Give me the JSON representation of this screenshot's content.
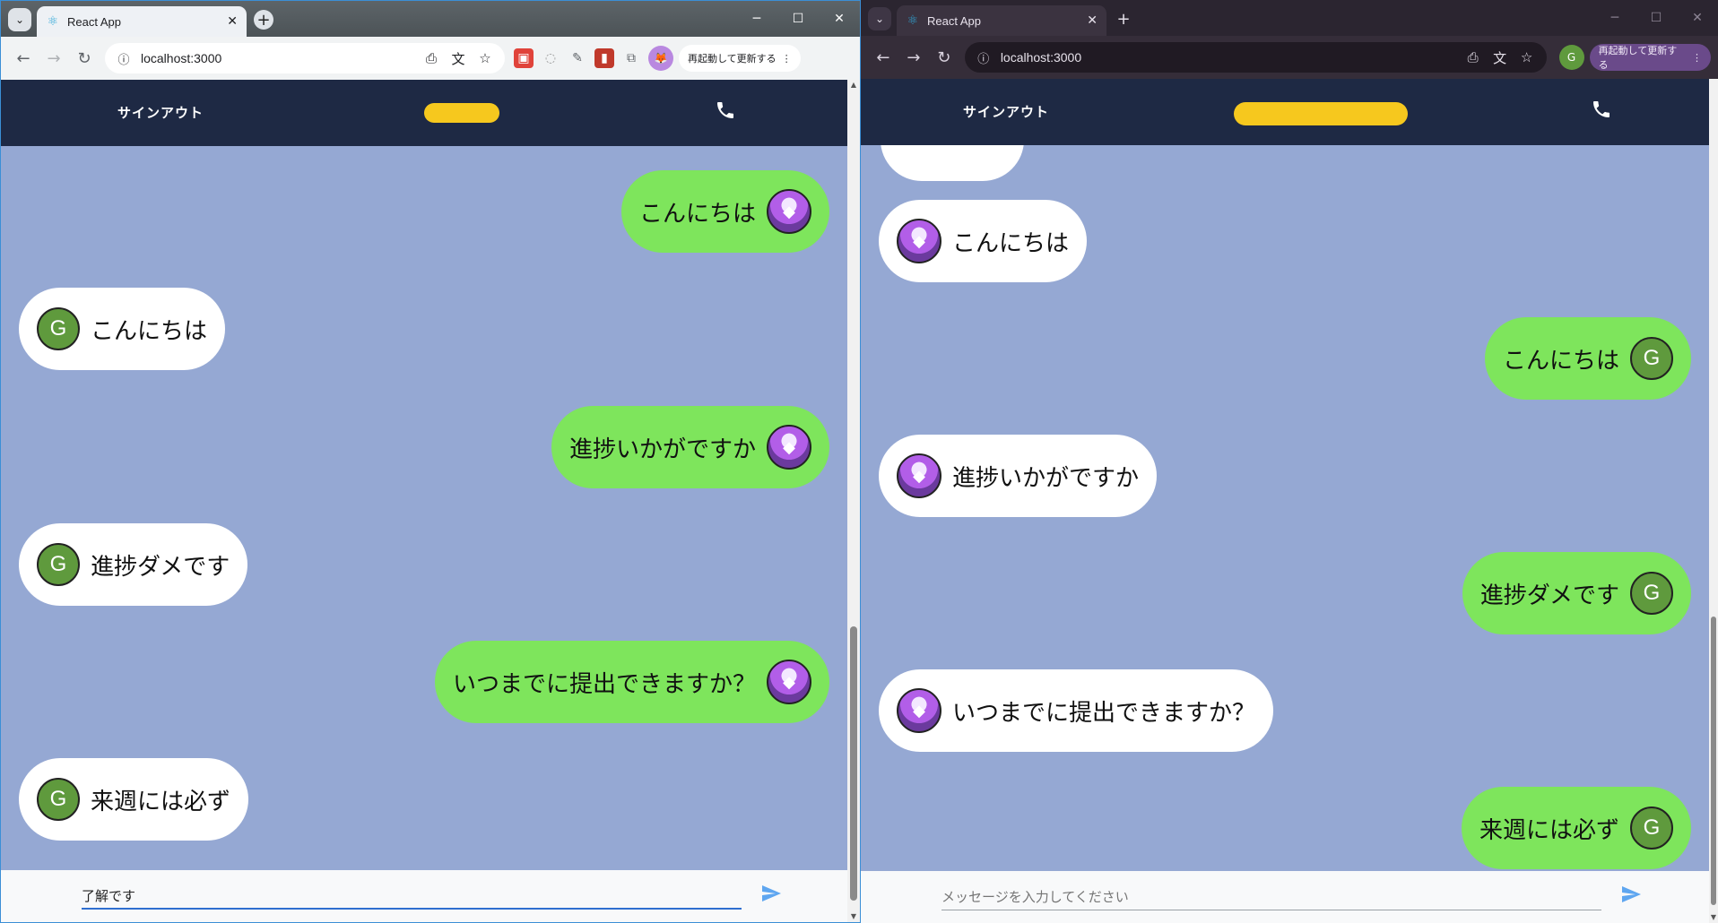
{
  "left": {
    "tab_title": "React App",
    "url": "localhost:3000",
    "relaunch_label": "再起動して更新する",
    "header": {
      "signout": "サインアウト"
    },
    "messages": [
      {
        "side": "mine",
        "text": "こんにちは"
      },
      {
        "side": "theirs",
        "text": "こんにちは",
        "avatar": "G"
      },
      {
        "side": "mine",
        "text": "進捗いかがですか"
      },
      {
        "side": "theirs",
        "text": "進捗ダメです",
        "avatar": "G"
      },
      {
        "side": "mine",
        "text": "いつまでに提出できますか？"
      },
      {
        "side": "theirs",
        "text": "来週には必ず",
        "avatar": "G"
      }
    ],
    "input_value": "了解です"
  },
  "right": {
    "tab_title": "React App",
    "url": "localhost:3000",
    "relaunch_label": "再起動して更新する",
    "profile_letter": "G",
    "header": {
      "signout": "サインアウト"
    },
    "messages": [
      {
        "side": "theirs",
        "text": "こんにちは"
      },
      {
        "side": "mine",
        "text": "こんにちは",
        "avatar": "G"
      },
      {
        "side": "theirs",
        "text": "進捗いかがですか"
      },
      {
        "side": "mine",
        "text": "進捗ダメです",
        "avatar": "G"
      },
      {
        "side": "theirs",
        "text": "いつまでに提出できますか？"
      },
      {
        "side": "mine",
        "text": "来週には必ず",
        "avatar": "G"
      }
    ],
    "input_placeholder": "メッセージを入力してください"
  },
  "colors": {
    "header_bg": "#1e2944",
    "chat_bg": "#95a8d3",
    "mine_bubble": "#7ee55c",
    "theirs_bubble": "#ffffff",
    "avatar_g": "#5f9a3d",
    "scribble": "#f6c81e",
    "send_icon": "#5ea6f0"
  },
  "icons": [
    "tab-dropdown-icon",
    "react-favicon-icon",
    "close-icon",
    "plus-icon",
    "minimize-icon",
    "maximize-icon",
    "back-icon",
    "forward-icon",
    "reload-icon",
    "site-info-icon",
    "install-icon",
    "translate-icon",
    "star-icon",
    "extension-icon",
    "kebab-menu-icon",
    "phone-icon",
    "send-icon"
  ]
}
